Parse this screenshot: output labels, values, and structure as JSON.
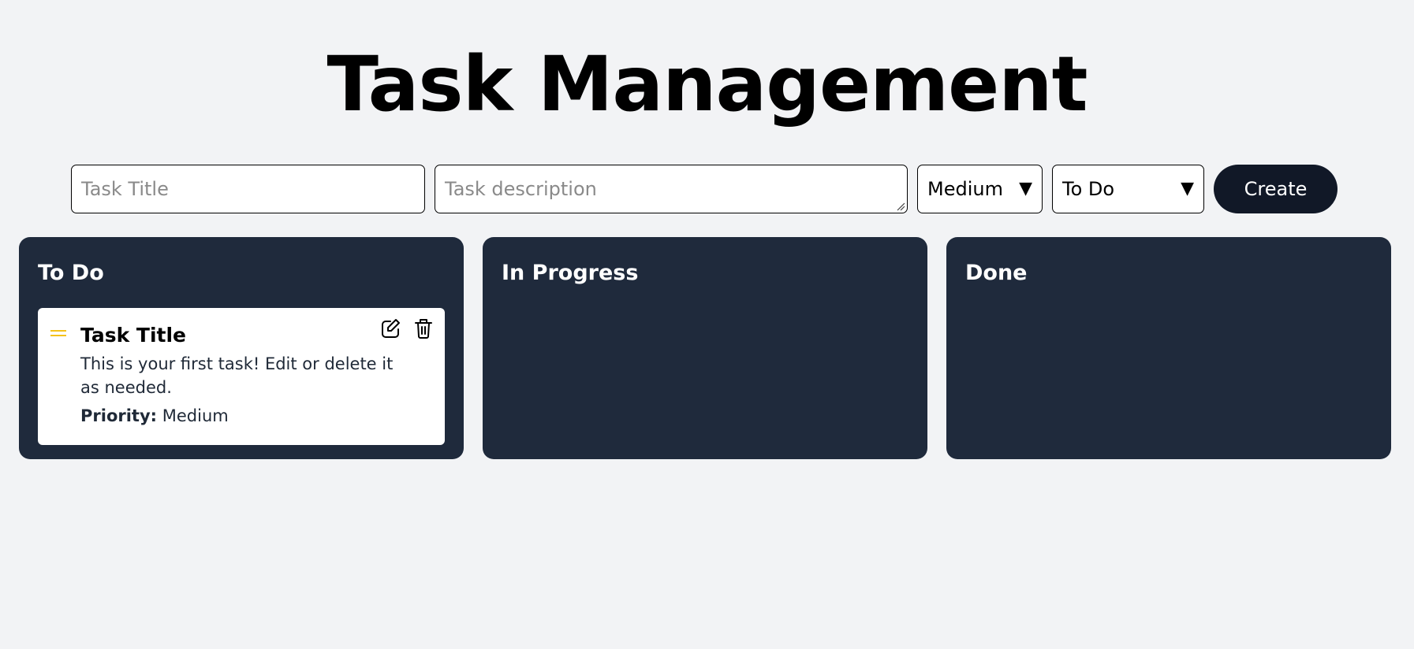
{
  "header": {
    "title": "Task Management"
  },
  "form": {
    "title_placeholder": "Task Title",
    "description_placeholder": "Task description",
    "priority_value": "Medium",
    "status_value": "To Do",
    "create_label": "Create",
    "caret_glyph": "▼"
  },
  "columns": [
    {
      "title": "To Do",
      "tasks": [
        {
          "title": "Task Title",
          "description": "This is your first task! Edit or delete it as needed.",
          "priority_label": "Priority:",
          "priority_value": "Medium"
        }
      ]
    },
    {
      "title": "In Progress",
      "tasks": []
    },
    {
      "title": "Done",
      "tasks": []
    }
  ],
  "colors": {
    "background": "#f2f3f5",
    "column": "#1f2a3c",
    "button": "#111827",
    "drag_handle": "#f4c21b"
  },
  "icons": {
    "drag": "drag-handle-icon",
    "edit": "edit-icon",
    "delete": "trash-icon",
    "caret": "chevron-down-icon"
  }
}
